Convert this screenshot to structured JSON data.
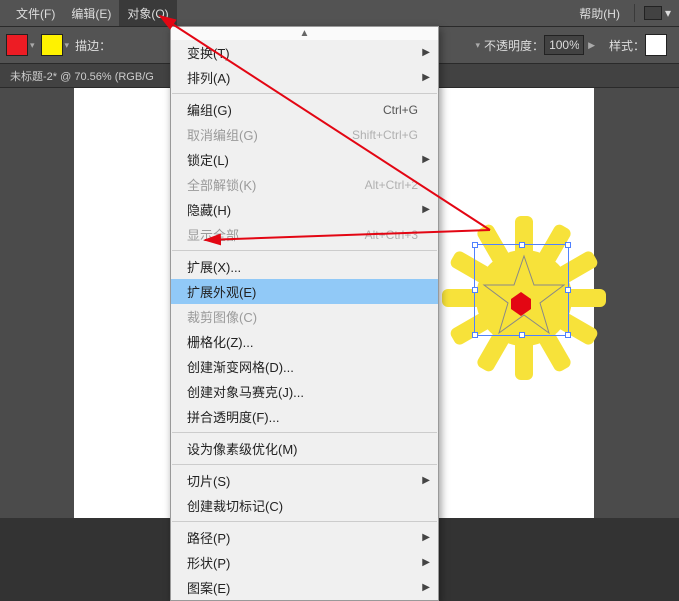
{
  "menubar": {
    "file": "文件(F)",
    "edit": "编辑(E)",
    "object": "对象(O)",
    "help": "帮助(H)"
  },
  "toolbar": {
    "stroke_label": "描边：",
    "opacity_label": "不透明度：",
    "opacity_value": "100%",
    "style_label": "样式：",
    "fill_color": "#ed1c24",
    "stroke_color": "#fff200"
  },
  "doctab": {
    "title": "未标题-2* @ 70.56% (RGB/G"
  },
  "menu": {
    "transform": {
      "label": "变换(T)"
    },
    "arrange": {
      "label": "排列(A)"
    },
    "group": {
      "label": "编组(G)",
      "shortcut": "Ctrl+G"
    },
    "ungroup": {
      "label": "取消编组(G)",
      "shortcut": "Shift+Ctrl+G"
    },
    "lock": {
      "label": "锁定(L)"
    },
    "unlock_all": {
      "label": "全部解锁(K)",
      "shortcut": "Alt+Ctrl+2"
    },
    "hide": {
      "label": "隐藏(H)"
    },
    "show_all": {
      "label": "显示全部",
      "shortcut": "Alt+Ctrl+3"
    },
    "expand": {
      "label": "扩展(X)..."
    },
    "expand_appearance": {
      "label": "扩展外观(E)"
    },
    "crop_image": {
      "label": "裁剪图像(C)"
    },
    "rasterize": {
      "label": "栅格化(Z)..."
    },
    "gradient_mesh": {
      "label": "创建渐变网格(D)..."
    },
    "object_mosaic": {
      "label": "创建对象马赛克(J)..."
    },
    "flatten_transparency": {
      "label": "拼合透明度(F)..."
    },
    "pixel_perfect": {
      "label": "设为像素级优化(M)"
    },
    "slice": {
      "label": "切片(S)"
    },
    "trim_marks": {
      "label": "创建裁切标记(C)"
    },
    "path": {
      "label": "路径(P)"
    },
    "shape": {
      "label": "形状(P)"
    },
    "pattern": {
      "label": "图案(E)"
    }
  }
}
